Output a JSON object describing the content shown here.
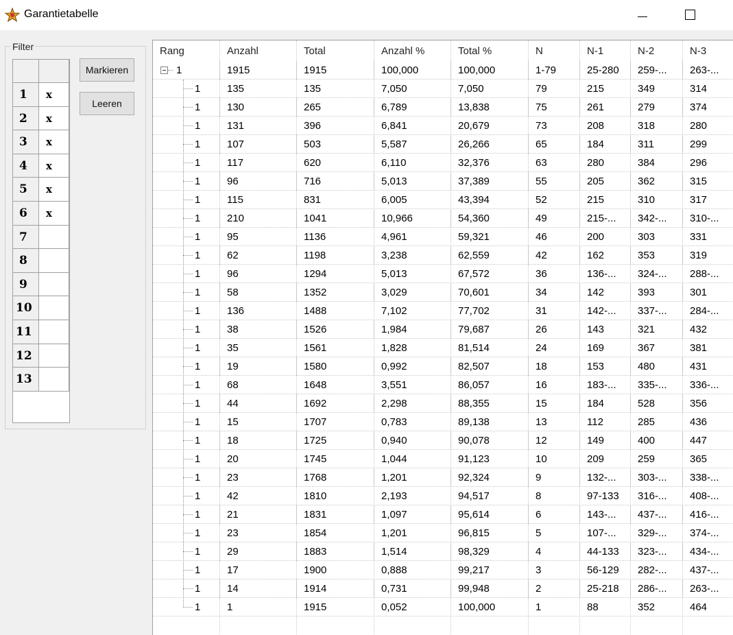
{
  "window": {
    "title": "Garantietabelle"
  },
  "filter": {
    "legend": "Filter",
    "rows": [
      {
        "num": "1",
        "mark": "x"
      },
      {
        "num": "2",
        "mark": "x"
      },
      {
        "num": "3",
        "mark": "x"
      },
      {
        "num": "4",
        "mark": "x"
      },
      {
        "num": "5",
        "mark": "x"
      },
      {
        "num": "6",
        "mark": "x"
      },
      {
        "num": "7",
        "mark": ""
      },
      {
        "num": "8",
        "mark": ""
      },
      {
        "num": "9",
        "mark": ""
      },
      {
        "num": "10",
        "mark": ""
      },
      {
        "num": "11",
        "mark": ""
      },
      {
        "num": "12",
        "mark": ""
      },
      {
        "num": "13",
        "mark": ""
      }
    ],
    "buttons": {
      "mark": "Markieren",
      "clear": "Leeren"
    }
  },
  "table": {
    "columns": [
      "Rang",
      "Anzahl",
      "Total",
      "Anzahl %",
      "Total %",
      "N",
      "N-1",
      "N-2",
      "N-3"
    ],
    "root": [
      "1",
      "1915",
      "1915",
      "100,000",
      "100,000",
      "1-79",
      "25-280",
      "259-...",
      "263-..."
    ],
    "rows": [
      [
        "1",
        "135",
        "135",
        "7,050",
        "7,050",
        "79",
        "215",
        "349",
        "314"
      ],
      [
        "1",
        "130",
        "265",
        "6,789",
        "13,838",
        "75",
        "261",
        "279",
        "374"
      ],
      [
        "1",
        "131",
        "396",
        "6,841",
        "20,679",
        "73",
        "208",
        "318",
        "280"
      ],
      [
        "1",
        "107",
        "503",
        "5,587",
        "26,266",
        "65",
        "184",
        "311",
        "299"
      ],
      [
        "1",
        "117",
        "620",
        "6,110",
        "32,376",
        "63",
        "280",
        "384",
        "296"
      ],
      [
        "1",
        "96",
        "716",
        "5,013",
        "37,389",
        "55",
        "205",
        "362",
        "315"
      ],
      [
        "1",
        "115",
        "831",
        "6,005",
        "43,394",
        "52",
        "215",
        "310",
        "317"
      ],
      [
        "1",
        "210",
        "1041",
        "10,966",
        "54,360",
        "49",
        "215-...",
        "342-...",
        "310-..."
      ],
      [
        "1",
        "95",
        "1136",
        "4,961",
        "59,321",
        "46",
        "200",
        "303",
        "331"
      ],
      [
        "1",
        "62",
        "1198",
        "3,238",
        "62,559",
        "42",
        "162",
        "353",
        "319"
      ],
      [
        "1",
        "96",
        "1294",
        "5,013",
        "67,572",
        "36",
        "136-...",
        "324-...",
        "288-..."
      ],
      [
        "1",
        "58",
        "1352",
        "3,029",
        "70,601",
        "34",
        "142",
        "393",
        "301"
      ],
      [
        "1",
        "136",
        "1488",
        "7,102",
        "77,702",
        "31",
        "142-...",
        "337-...",
        "284-..."
      ],
      [
        "1",
        "38",
        "1526",
        "1,984",
        "79,687",
        "26",
        "143",
        "321",
        "432"
      ],
      [
        "1",
        "35",
        "1561",
        "1,828",
        "81,514",
        "24",
        "169",
        "367",
        "381"
      ],
      [
        "1",
        "19",
        "1580",
        "0,992",
        "82,507",
        "18",
        "153",
        "480",
        "431"
      ],
      [
        "1",
        "68",
        "1648",
        "3,551",
        "86,057",
        "16",
        "183-...",
        "335-...",
        "336-..."
      ],
      [
        "1",
        "44",
        "1692",
        "2,298",
        "88,355",
        "15",
        "184",
        "528",
        "356"
      ],
      [
        "1",
        "15",
        "1707",
        "0,783",
        "89,138",
        "13",
        "112",
        "285",
        "436"
      ],
      [
        "1",
        "18",
        "1725",
        "0,940",
        "90,078",
        "12",
        "149",
        "400",
        "447"
      ],
      [
        "1",
        "20",
        "1745",
        "1,044",
        "91,123",
        "10",
        "209",
        "259",
        "365"
      ],
      [
        "1",
        "23",
        "1768",
        "1,201",
        "92,324",
        "9",
        "132-...",
        "303-...",
        "338-..."
      ],
      [
        "1",
        "42",
        "1810",
        "2,193",
        "94,517",
        "8",
        "97-133",
        "316-...",
        "408-..."
      ],
      [
        "1",
        "21",
        "1831",
        "1,097",
        "95,614",
        "6",
        "143-...",
        "437-...",
        "416-..."
      ],
      [
        "1",
        "23",
        "1854",
        "1,201",
        "96,815",
        "5",
        "107-...",
        "329-...",
        "374-..."
      ],
      [
        "1",
        "29",
        "1883",
        "1,514",
        "98,329",
        "4",
        "44-133",
        "323-...",
        "434-..."
      ],
      [
        "1",
        "17",
        "1900",
        "0,888",
        "99,217",
        "3",
        "56-129",
        "282-...",
        "437-..."
      ],
      [
        "1",
        "14",
        "1914",
        "0,731",
        "99,948",
        "2",
        "25-218",
        "286-...",
        "263-..."
      ],
      [
        "1",
        "1",
        "1915",
        "0,052",
        "100,000",
        "1",
        "88",
        "352",
        "464"
      ]
    ]
  }
}
